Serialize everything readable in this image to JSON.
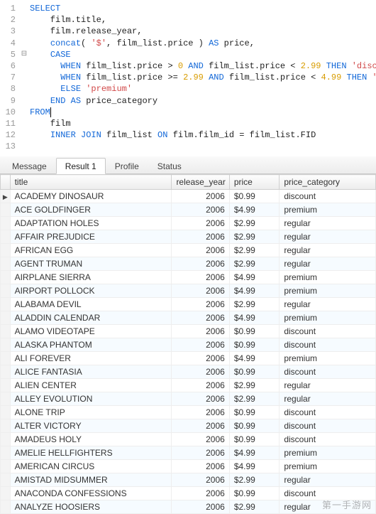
{
  "editor": {
    "lines": [
      {
        "n": 1,
        "tokens": [
          [
            "kw",
            "SELECT"
          ]
        ]
      },
      {
        "n": 2,
        "tokens": [
          [
            "plain",
            "    film.title,"
          ]
        ]
      },
      {
        "n": 3,
        "tokens": [
          [
            "plain",
            "    film.release_year,"
          ]
        ]
      },
      {
        "n": 4,
        "tokens": [
          [
            "plain",
            "    "
          ],
          [
            "fn",
            "concat"
          ],
          [
            "plain",
            "( "
          ],
          [
            "str",
            "'$'"
          ],
          [
            "plain",
            ", film_list.price ) "
          ],
          [
            "kw",
            "AS"
          ],
          [
            "plain",
            " price,"
          ]
        ]
      },
      {
        "n": 5,
        "gutter": "⊟",
        "tokens": [
          [
            "plain",
            "    "
          ],
          [
            "kw",
            "CASE"
          ]
        ]
      },
      {
        "n": 6,
        "tokens": [
          [
            "plain",
            "      "
          ],
          [
            "kw",
            "WHEN"
          ],
          [
            "plain",
            " film_list.price > "
          ],
          [
            "num",
            "0"
          ],
          [
            "plain",
            " "
          ],
          [
            "kw",
            "AND"
          ],
          [
            "plain",
            " film_list.price < "
          ],
          [
            "num",
            "2.99"
          ],
          [
            "plain",
            " "
          ],
          [
            "kw",
            "THEN"
          ],
          [
            "plain",
            " "
          ],
          [
            "str",
            "'discount'"
          ]
        ]
      },
      {
        "n": 7,
        "tokens": [
          [
            "plain",
            "      "
          ],
          [
            "kw",
            "WHEN"
          ],
          [
            "plain",
            " film_list.price >= "
          ],
          [
            "num",
            "2.99"
          ],
          [
            "plain",
            " "
          ],
          [
            "kw",
            "AND"
          ],
          [
            "plain",
            " film_list.price < "
          ],
          [
            "num",
            "4.99"
          ],
          [
            "plain",
            " "
          ],
          [
            "kw",
            "THEN"
          ],
          [
            "plain",
            " "
          ],
          [
            "str",
            "'regular'"
          ]
        ]
      },
      {
        "n": 8,
        "tokens": [
          [
            "plain",
            "      "
          ],
          [
            "kw",
            "ELSE"
          ],
          [
            "plain",
            " "
          ],
          [
            "str",
            "'premium'"
          ]
        ]
      },
      {
        "n": 9,
        "tokens": [
          [
            "plain",
            "    "
          ],
          [
            "kw",
            "END"
          ],
          [
            "plain",
            " "
          ],
          [
            "kw",
            "AS"
          ],
          [
            "plain",
            " price_category"
          ]
        ]
      },
      {
        "n": 10,
        "cursor": true,
        "tokens": [
          [
            "kw",
            "FROM"
          ]
        ]
      },
      {
        "n": 11,
        "tokens": [
          [
            "plain",
            "    film"
          ]
        ]
      },
      {
        "n": 12,
        "tokens": [
          [
            "plain",
            "    "
          ],
          [
            "kw",
            "INNER JOIN"
          ],
          [
            "plain",
            " film_list "
          ],
          [
            "kw",
            "ON"
          ],
          [
            "plain",
            " film.film_id = film_list.FID"
          ]
        ]
      },
      {
        "n": 13,
        "tokens": []
      }
    ]
  },
  "tabs": {
    "items": [
      {
        "label": "Message",
        "active": false
      },
      {
        "label": "Result 1",
        "active": true
      },
      {
        "label": "Profile",
        "active": false
      },
      {
        "label": "Status",
        "active": false
      }
    ]
  },
  "grid": {
    "columns": [
      "title",
      "release_year",
      "price",
      "price_category"
    ],
    "rows": [
      {
        "title": "ACADEMY DINOSAUR",
        "release_year": 2006,
        "price": "$0.99",
        "price_category": "discount",
        "current": true
      },
      {
        "title": "ACE GOLDFINGER",
        "release_year": 2006,
        "price": "$4.99",
        "price_category": "premium"
      },
      {
        "title": "ADAPTATION HOLES",
        "release_year": 2006,
        "price": "$2.99",
        "price_category": "regular"
      },
      {
        "title": "AFFAIR PREJUDICE",
        "release_year": 2006,
        "price": "$2.99",
        "price_category": "regular"
      },
      {
        "title": "AFRICAN EGG",
        "release_year": 2006,
        "price": "$2.99",
        "price_category": "regular"
      },
      {
        "title": "AGENT TRUMAN",
        "release_year": 2006,
        "price": "$2.99",
        "price_category": "regular"
      },
      {
        "title": "AIRPLANE SIERRA",
        "release_year": 2006,
        "price": "$4.99",
        "price_category": "premium"
      },
      {
        "title": "AIRPORT POLLOCK",
        "release_year": 2006,
        "price": "$4.99",
        "price_category": "premium"
      },
      {
        "title": "ALABAMA DEVIL",
        "release_year": 2006,
        "price": "$2.99",
        "price_category": "regular"
      },
      {
        "title": "ALADDIN CALENDAR",
        "release_year": 2006,
        "price": "$4.99",
        "price_category": "premium"
      },
      {
        "title": "ALAMO VIDEOTAPE",
        "release_year": 2006,
        "price": "$0.99",
        "price_category": "discount"
      },
      {
        "title": "ALASKA PHANTOM",
        "release_year": 2006,
        "price": "$0.99",
        "price_category": "discount"
      },
      {
        "title": "ALI FOREVER",
        "release_year": 2006,
        "price": "$4.99",
        "price_category": "premium"
      },
      {
        "title": "ALICE FANTASIA",
        "release_year": 2006,
        "price": "$0.99",
        "price_category": "discount"
      },
      {
        "title": "ALIEN CENTER",
        "release_year": 2006,
        "price": "$2.99",
        "price_category": "regular"
      },
      {
        "title": "ALLEY EVOLUTION",
        "release_year": 2006,
        "price": "$2.99",
        "price_category": "regular"
      },
      {
        "title": "ALONE TRIP",
        "release_year": 2006,
        "price": "$0.99",
        "price_category": "discount"
      },
      {
        "title": "ALTER VICTORY",
        "release_year": 2006,
        "price": "$0.99",
        "price_category": "discount"
      },
      {
        "title": "AMADEUS HOLY",
        "release_year": 2006,
        "price": "$0.99",
        "price_category": "discount"
      },
      {
        "title": "AMELIE HELLFIGHTERS",
        "release_year": 2006,
        "price": "$4.99",
        "price_category": "premium"
      },
      {
        "title": "AMERICAN CIRCUS",
        "release_year": 2006,
        "price": "$4.99",
        "price_category": "premium"
      },
      {
        "title": "AMISTAD MIDSUMMER",
        "release_year": 2006,
        "price": "$2.99",
        "price_category": "regular"
      },
      {
        "title": "ANACONDA CONFESSIONS",
        "release_year": 2006,
        "price": "$0.99",
        "price_category": "discount"
      },
      {
        "title": "ANALYZE HOOSIERS",
        "release_year": 2006,
        "price": "$2.99",
        "price_category": "regular"
      }
    ]
  },
  "watermark": "第一手游网"
}
